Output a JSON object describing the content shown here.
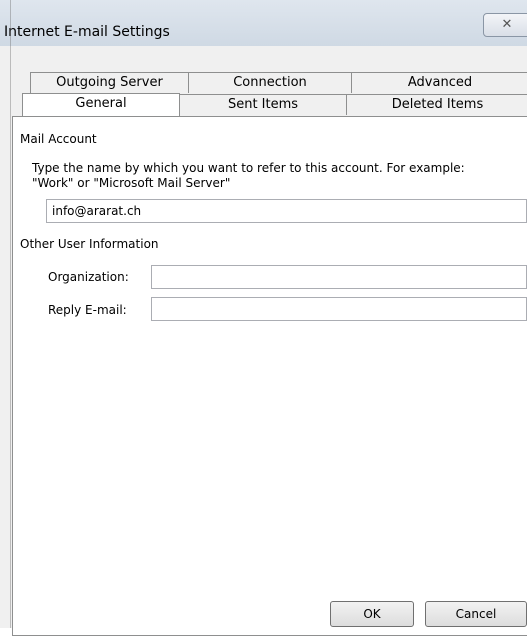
{
  "window": {
    "title": "Internet E-mail Settings",
    "close_glyph": "✕"
  },
  "tabs": {
    "row_back": [
      "Outgoing Server",
      "Connection",
      "Advanced"
    ],
    "row_front": [
      "General",
      "Sent Items",
      "Deleted Items"
    ],
    "active": "General"
  },
  "mail_account": {
    "legend": "Mail Account",
    "description": "Type the name by which you want to refer to this account. For example: \"Work\" or \"Microsoft Mail Server\"",
    "value": "info@ararat.ch"
  },
  "other_user_info": {
    "legend": "Other User Information",
    "organization_label": "Organization:",
    "organization_value": "",
    "reply_email_label": "Reply E-mail:",
    "reply_email_value": ""
  },
  "buttons": {
    "ok": "OK",
    "cancel": "Cancel"
  },
  "colors": {
    "tab_border": "#8e8f8f",
    "panel_bg": "#ffffff",
    "dialog_bg": "#f0f0f0"
  }
}
